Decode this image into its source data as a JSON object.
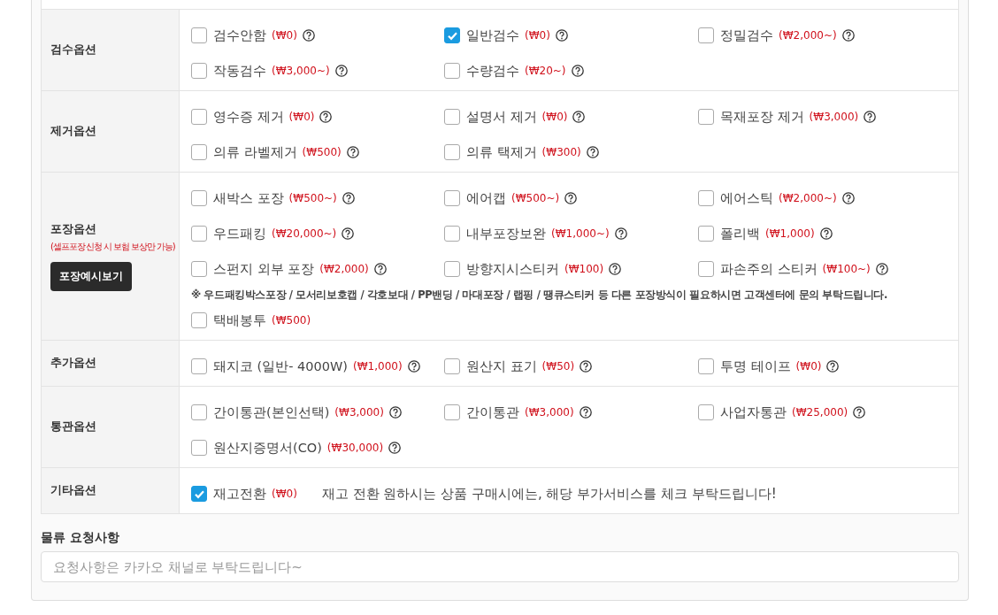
{
  "sections": [
    {
      "label": "검수옵션",
      "options": [
        {
          "name": "검수안함",
          "price": "(₩0)",
          "checked": false,
          "help": true
        },
        {
          "name": "일반검수",
          "price": "(₩0)",
          "checked": true,
          "help": true
        },
        {
          "name": "정밀검수",
          "price": "(₩2,000~)",
          "checked": false,
          "help": true
        },
        {
          "name": "작동검수",
          "price": "(₩3,000~)",
          "checked": false,
          "help": true
        },
        {
          "name": "수량검수",
          "price": "(₩20~)",
          "checked": false,
          "help": true
        }
      ]
    },
    {
      "label": "제거옵션",
      "options": [
        {
          "name": "영수증 제거",
          "price": "(₩0)",
          "checked": false,
          "help": true
        },
        {
          "name": "설명서 제거",
          "price": "(₩0)",
          "checked": false,
          "help": true
        },
        {
          "name": "목재포장 제거",
          "price": "(₩3,000)",
          "checked": false,
          "help": true
        },
        {
          "name": "의류 라벨제거",
          "price": "(₩500)",
          "checked": false,
          "help": true
        },
        {
          "name": "의류 택제거",
          "price": "(₩300)",
          "checked": false,
          "help": true
        }
      ]
    },
    {
      "label": "포장옵션",
      "sublabel": "(셀프포장 신청 시 보험 보상만 가능)",
      "button": "포장예시보기",
      "options": [
        {
          "name": "새박스 포장",
          "price": "(₩500~)",
          "checked": false,
          "help": true
        },
        {
          "name": "에어캡",
          "price": "(₩500~)",
          "checked": false,
          "help": true
        },
        {
          "name": "에어스틱",
          "price": "(₩2,000~)",
          "checked": false,
          "help": true
        },
        {
          "name": "우드패킹",
          "price": "(₩20,000~)",
          "checked": false,
          "help": true
        },
        {
          "name": "내부포장보완",
          "price": "(₩1,000~)",
          "checked": false,
          "help": true
        },
        {
          "name": "폴리백",
          "price": "(₩1,000)",
          "checked": false,
          "help": true
        },
        {
          "name": "스펀지 외부 포장",
          "price": "(₩2,000)",
          "checked": false,
          "help": true
        },
        {
          "name": "방향지시스티커",
          "price": "(₩100)",
          "checked": false,
          "help": true
        },
        {
          "name": "파손주의 스티커",
          "price": "(₩100~)",
          "checked": false,
          "help": true
        }
      ],
      "note": "※ 우드패킹박스포장 / 모서리보호캡 / 각호보대 / PP밴딩 / 마대포장 / 랩핑 / 땡큐스티커 등 다른 포장방식이 필요하시면 고객센터에 문의 부탁드립니다.",
      "extra_options": [
        {
          "name": "택배봉투",
          "price": "(₩500)",
          "checked": false,
          "help": false
        }
      ]
    },
    {
      "label": "추가옵션",
      "options": [
        {
          "name": "돼지코 (일반- 4000W)",
          "price": "(₩1,000)",
          "checked": false,
          "help": true
        },
        {
          "name": "원산지 표기",
          "price": "(₩50)",
          "checked": false,
          "help": true
        },
        {
          "name": "투명 테이프",
          "price": "(₩0)",
          "checked": false,
          "help": true
        }
      ]
    },
    {
      "label": "통관옵션",
      "options": [
        {
          "name": "간이통관(본인선택)",
          "price": "(₩3,000)",
          "checked": false,
          "help": true
        },
        {
          "name": "간이통관",
          "price": "(₩3,000)",
          "checked": false,
          "help": true
        },
        {
          "name": "사업자통관",
          "price": "(₩25,000)",
          "checked": false,
          "help": true
        },
        {
          "name": "원산지증명서(CO)",
          "price": "(₩30,000)",
          "checked": false,
          "help": true
        }
      ]
    },
    {
      "label": "기타옵션",
      "options": [
        {
          "name": "재고전환",
          "price": "(₩0)",
          "checked": true,
          "help": false
        }
      ],
      "message": "재고 전환 원하시는 상품 구매시에는, 해당 부가서비스를 체크 부탁드립니다!"
    }
  ],
  "request": {
    "label": "물류 요청사항",
    "placeholder": "요청사항은 카카오 채널로 부탁드립니다~"
  }
}
